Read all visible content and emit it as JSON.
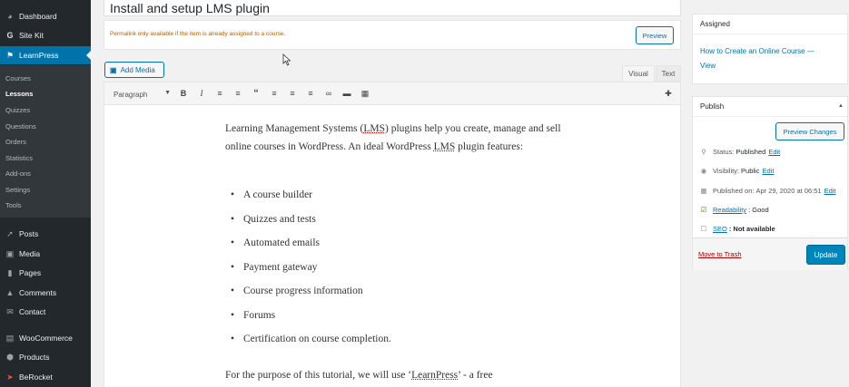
{
  "sidebar": {
    "items": [
      {
        "label": "Dashboard",
        "icon": "dashboard-icon"
      },
      {
        "label": "Site Kit",
        "icon": "sitekit-icon"
      },
      {
        "label": "LearnPress",
        "icon": "graduation-cap-icon",
        "current": true
      },
      {
        "label": "Posts",
        "icon": "pin-icon"
      },
      {
        "label": "Media",
        "icon": "media-icon"
      },
      {
        "label": "Pages",
        "icon": "pages-icon"
      },
      {
        "label": "Comments",
        "icon": "comment-icon"
      },
      {
        "label": "Contact",
        "icon": "envelope-icon"
      },
      {
        "label": "WooCommerce",
        "icon": "woocommerce-icon"
      },
      {
        "label": "Products",
        "icon": "box-icon"
      },
      {
        "label": "BeRocket",
        "icon": "rocket-icon"
      }
    ],
    "submenu": [
      "Courses",
      "Lessons",
      "Quizzes",
      "Questions",
      "Orders",
      "Statistics",
      "Add-ons",
      "Settings",
      "Tools"
    ]
  },
  "editor": {
    "title": "Install and setup LMS plugin",
    "permalink_note": "Permalink only available if the item is already assigned to a course.",
    "preview_label": "Preview",
    "add_media_label": "Add Media",
    "tab_visual": "Visual",
    "tab_text": "Text",
    "format_select": "Paragraph",
    "content": {
      "intro_a": "Learning Management Systems (",
      "intro_lms1": "LMS",
      "intro_b": ") plugins help you create, manage and sell online courses in WordPress. An ideal WordPress ",
      "intro_lms2": "LMS",
      "intro_c": " plugin features:",
      "features": [
        "A course builder",
        "Quizzes and tests",
        "Automated emails",
        "Payment gateway",
        "Course progress information",
        "Forums",
        "Certification on course completion."
      ],
      "closing_a": "For the purpose of this tutorial, we will use ‘",
      "closing_lp": "LearnPress",
      "closing_b": "’ - a free"
    }
  },
  "assigned": {
    "title": "Assigned",
    "course_link": "How to Create an Online Course —",
    "view_link": "View"
  },
  "publish": {
    "title": "Publish",
    "preview_changes": "Preview Changes",
    "status_label": "Status:",
    "status_value": "Published",
    "visibility_label": "Visibility:",
    "visibility_value": "Public",
    "published_label": "Published on:",
    "published_value": "Apr 29, 2020 at 06:51",
    "edit_link": "Edit",
    "readability_link": "Readability",
    "readability_value": ": Good",
    "seo_link": "SEO",
    "seo_value": ": Not available",
    "move_trash": "Move to Trash",
    "update": "Update"
  },
  "colors": {
    "admin_bar": "#23282d",
    "accent": "#0073aa",
    "update_button": "#0085ba",
    "trash": "#aa0000"
  }
}
